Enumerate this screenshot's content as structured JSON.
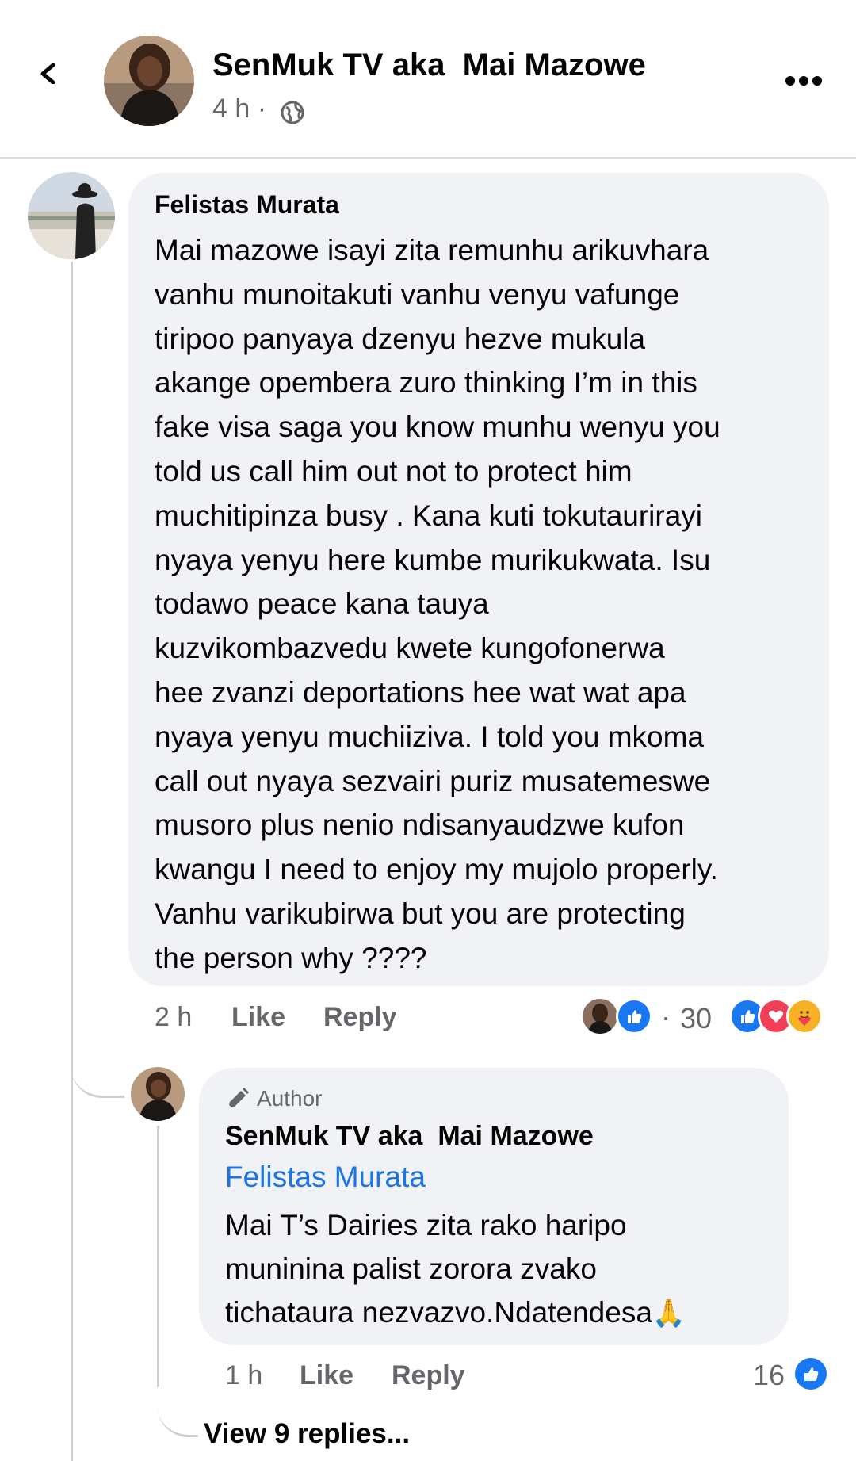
{
  "header": {
    "author_name": "SenMuk TV aka  Mai Mazowe",
    "time": "4 h ·",
    "icons": {
      "back": "chevron-left-icon",
      "privacy": "globe-icon",
      "more": "more-dots-icon"
    }
  },
  "comment": {
    "author": "Felistas Murata",
    "text": "Mai mazowe isayi zita remunhu arikuvhara\nvanhu munoitakuti vanhu venyu vafunge\ntiripoo panyaya dzenyu hezve mukula\nakange opembera zuro thinking I’m in this\nfake visa saga you know munhu wenyu you\ntold us call him out not to protect him\nmuchitipinza busy . Kana kuti tokutaurirayi\nnyaya yenyu here kumbe murikukwata. Isu\ntodawo peace kana tauya\nkuzvikombazvedu kwete kungofonerwa\nhee zvanzi deportations hee wat wat apa\nnyaya yenyu muchiiziva. I told you mkoma\ncall out nyaya sezvairi puriz musatemeswe\nmusoro plus nenio ndisanyaudzwe kufon\nkwangu I need to enjoy my mujolo properly.\nVanhu varikubirwa but you are protecting\nthe person why ????",
    "time": "2 h",
    "like_label": "Like",
    "reply_label": "Reply",
    "reply_dot": "·",
    "reaction_count": "30",
    "reactions": [
      "like",
      "love",
      "care"
    ],
    "colors": {
      "like": "#1877f2",
      "love": "#f33e58",
      "care": "#f7b125"
    }
  },
  "reply": {
    "badge": "Author",
    "author": "SenMuk TV aka  Mai Mazowe",
    "mention": "Felistas Murata",
    "text": "Mai T’s Dairies zita rako haripo\nmuninina palist zorora zvako\ntichataura nezvazvo.Ndatendesa",
    "emoji": "🙏",
    "time": "1 h",
    "like_label": "Like",
    "reply_label": "Reply",
    "reaction_count": "16"
  },
  "view_replies": "View 9 replies..."
}
